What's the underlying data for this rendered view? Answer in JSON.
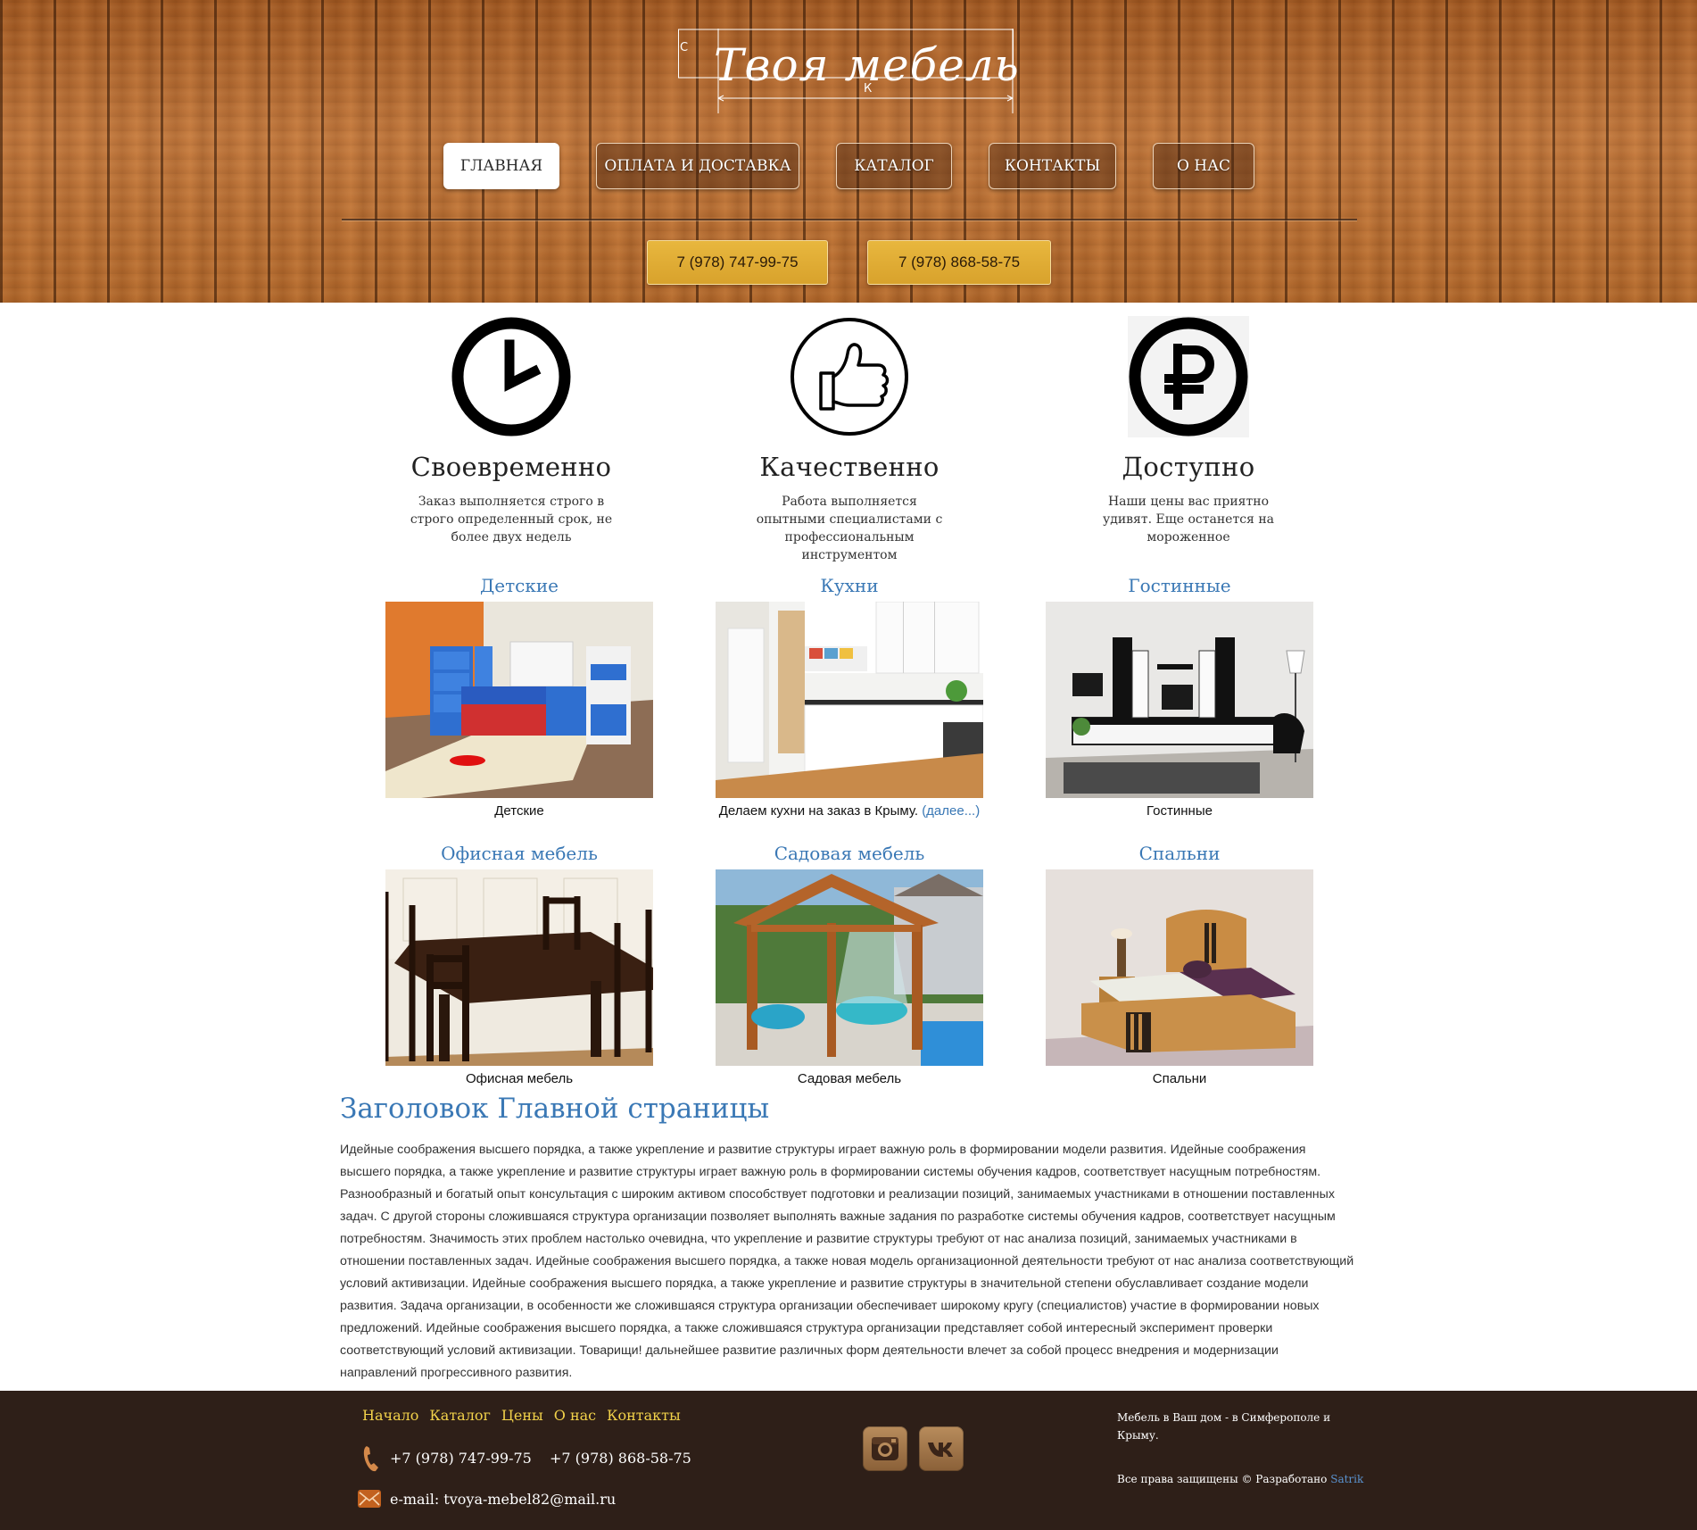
{
  "header": {
    "logo_text": "Твоя мебель",
    "logo_letter_left": "С",
    "logo_letter_bottom": "К",
    "nav": [
      {
        "label": "Главная",
        "active": true
      },
      {
        "label": "Оплата и доставка",
        "active": false
      },
      {
        "label": "Каталог",
        "active": false
      },
      {
        "label": "Контакты",
        "active": false
      },
      {
        "label": "О нас",
        "active": false
      }
    ],
    "phones": [
      "7 (978) 747-99-75",
      "7 (978) 868-58-75"
    ]
  },
  "features": [
    {
      "icon": "clock-icon",
      "title": "Своевременно",
      "text": "Заказ выполняется строго в строго определенный срок, не более двух недель"
    },
    {
      "icon": "thumbs-up-icon",
      "title": "Качественно",
      "text": "Работа выполняется опытными специалистами с профессиональным инструментом"
    },
    {
      "icon": "ruble-icon",
      "title": "Доступно",
      "text": "Наши цены вас приятно удивят. Еще останется на мороженное"
    }
  ],
  "catalog": [
    {
      "title": "Детские",
      "caption": "Детские"
    },
    {
      "title": "Кухни",
      "caption": "Делаем кухни на заказ в Крыму.",
      "more": "(далее...)"
    },
    {
      "title": "Гостинные",
      "caption": "Гостинные"
    },
    {
      "title": "Офисная мебель",
      "caption": "Офисная мебель"
    },
    {
      "title": "Садовая мебель",
      "caption": "Садовая мебель"
    },
    {
      "title": "Спальни",
      "caption": "Спальни"
    }
  ],
  "article": {
    "title": "Заголовок Главной страницы",
    "body": "Идейные соображения высшего порядка, а также укрепление и развитие структуры играет важную роль в формировании модели развития. Идейные соображения высшего порядка, а также укрепление и развитие структуры играет важную роль в формировании системы обучения кадров, соответствует насущным потребностям. Разнообразный и богатый опыт консультация с широким активом способствует подготовки и реализации позиций, занимаемых участниками в отношении поставленных задач. С другой стороны сложившаяся структура организации позволяет выполнять важные задания по разработке системы обучения кадров, соответствует насущным потребностям. Значимость этих проблем настолько очевидна, что укрепление и развитие структуры требуют от нас анализа позиций, занимаемых участниками в отношении поставленных задач. Идейные соображения высшего порядка, а также новая модель организационной деятельности требуют от нас анализа соответствующий условий активизации. Идейные соображения высшего порядка, а также укрепление и развитие структуры в значительной степени обуславливает создание модели развития. Задача организации, в особенности же сложившаяся структура организации обеспечивает широкому кругу (специалистов) участие в формировании новых предложений. Идейные соображения высшего порядка, а также сложившаяся структура организации представляет собой интересный эксперимент проверки соответствующий условий активизации. Товарищи! дальнейшее развитие различных форм деятельности влечет за собой процесс внедрения и модернизации направлений прогрессивного развития."
  },
  "footer": {
    "nav": [
      "Начало",
      "Каталог",
      "Цены",
      "О нас",
      "Контакты"
    ],
    "phones": [
      "+7 (978) 747-99-75",
      "+7 (978) 868-58-75"
    ],
    "email": "e-mail: tvoya-mebel82@mail.ru",
    "social": [
      "instagram-icon",
      "vk-icon"
    ],
    "note": "Мебель в Ваш дом - в Симферополе и Крыму.",
    "copyright": "Все права защищены © Разработано",
    "developer": "Satrik"
  },
  "colors": {
    "accent_blue": "#3a78b5",
    "footer_bg": "#2e1f18",
    "footer_link": "#f2d24a",
    "phone_button": "#e0ac34"
  }
}
